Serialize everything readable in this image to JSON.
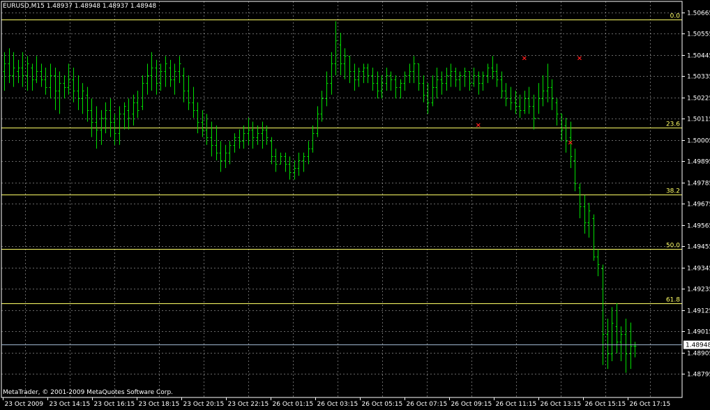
{
  "window": {
    "symbol_header": "EURUSD,M15  1.48937 1.48948 1.48937 1.48948",
    "copyright": "MetaTrader, © 2001-2009 MetaQuotes Software Corp."
  },
  "colors": {
    "background": "#000000",
    "grid": "#c0c0c0",
    "bars": "#00e000",
    "fibo": "#ffff66",
    "fractal": "#ff2020",
    "axis_text": "#ffffff",
    "current_price_line": "#a0b8d0"
  },
  "chart_data": {
    "type": "bar",
    "title": "EURUSD,M15",
    "symbol": "EURUSD",
    "timeframe": "M15",
    "last_quote": {
      "open": 1.48937,
      "high": 1.48948,
      "low": 1.48937,
      "close": 1.48948
    },
    "current_price": "1.48948",
    "y_ticks": [
      "1.50665",
      "1.50555",
      "1.50445",
      "1.50335",
      "1.50225",
      "1.50115",
      "1.50005",
      "1.49895",
      "1.49785",
      "1.49675",
      "1.49565",
      "1.49455",
      "1.49345",
      "1.49235",
      "1.49125",
      "1.49015",
      "1.48905",
      "1.48795"
    ],
    "x_ticks": [
      "23 Oct 2009",
      "23 Oct 14:15",
      "23 Oct 16:15",
      "23 Oct 18:15",
      "23 Oct 20:15",
      "23 Oct 22:15",
      "26 Oct 01:15",
      "26 Oct 03:15",
      "26 Oct 05:15",
      "26 Oct 07:15",
      "26 Oct 09:15",
      "26 Oct 11:15",
      "26 Oct 13:15",
      "26 Oct 15:15",
      "26 Oct 17:15"
    ],
    "ylim": [
      1.4874,
      1.5072
    ],
    "grid": true,
    "fibonacci_levels": [
      {
        "label": "0.0",
        "price": 1.5063
      },
      {
        "label": "23.6",
        "price": 1.50068
      },
      {
        "label": "38.2",
        "price": 1.49722
      },
      {
        "label": "50.0",
        "price": 1.4944
      },
      {
        "label": "61.8",
        "price": 1.4916
      }
    ],
    "ohlc": [
      {
        "h": 1.5046,
        "l": 1.5026,
        "o": 1.5036,
        "c": 1.504
      },
      {
        "h": 1.5048,
        "l": 1.503,
        "o": 1.504,
        "c": 1.5034
      },
      {
        "h": 1.5046,
        "l": 1.5028,
        "o": 1.5034,
        "c": 1.5038
      },
      {
        "h": 1.5042,
        "l": 1.503,
        "o": 1.5036,
        "c": 1.5038
      },
      {
        "h": 1.5046,
        "l": 1.5028,
        "o": 1.5038,
        "c": 1.5034
      },
      {
        "h": 1.5044,
        "l": 1.5026,
        "o": 1.5034,
        "c": 1.504
      },
      {
        "h": 1.504,
        "l": 1.5026,
        "o": 1.5038,
        "c": 1.5032
      },
      {
        "h": 1.5044,
        "l": 1.503,
        "o": 1.5032,
        "c": 1.5036
      },
      {
        "h": 1.504,
        "l": 1.5028,
        "o": 1.5036,
        "c": 1.5032
      },
      {
        "h": 1.5038,
        "l": 1.5024,
        "o": 1.5032,
        "c": 1.5028
      },
      {
        "h": 1.504,
        "l": 1.5022,
        "o": 1.5028,
        "c": 1.5034
      },
      {
        "h": 1.5038,
        "l": 1.5016,
        "o": 1.5034,
        "c": 1.5026
      },
      {
        "h": 1.5036,
        "l": 1.5014,
        "o": 1.5026,
        "c": 1.503
      },
      {
        "h": 1.5034,
        "l": 1.5022,
        "o": 1.503,
        "c": 1.5028
      },
      {
        "h": 1.504,
        "l": 1.5024,
        "o": 1.5028,
        "c": 1.5032
      },
      {
        "h": 1.5038,
        "l": 1.502,
        "o": 1.5032,
        "c": 1.5026
      },
      {
        "h": 1.5034,
        "l": 1.5016,
        "o": 1.5026,
        "c": 1.5022
      },
      {
        "h": 1.503,
        "l": 1.5014,
        "o": 1.5022,
        "c": 1.5026
      },
      {
        "h": 1.5028,
        "l": 1.501,
        "o": 1.5024,
        "c": 1.5016
      },
      {
        "h": 1.5022,
        "l": 1.5002,
        "o": 1.5016,
        "c": 1.501
      },
      {
        "h": 1.5018,
        "l": 1.4996,
        "o": 1.501,
        "c": 1.5006
      },
      {
        "h": 1.5016,
        "l": 1.4998,
        "o": 1.5006,
        "c": 1.5012
      },
      {
        "h": 1.502,
        "l": 1.5004,
        "o": 1.5012,
        "c": 1.5016
      },
      {
        "h": 1.5022,
        "l": 1.5002,
        "o": 1.5016,
        "c": 1.501
      },
      {
        "h": 1.5014,
        "l": 1.4998,
        "o": 1.501,
        "c": 1.5004
      },
      {
        "h": 1.5018,
        "l": 1.4998,
        "o": 1.5004,
        "c": 1.5014
      },
      {
        "h": 1.502,
        "l": 1.5006,
        "o": 1.5014,
        "c": 1.5018
      },
      {
        "h": 1.5022,
        "l": 1.5006,
        "o": 1.5016,
        "c": 1.5012
      },
      {
        "h": 1.5024,
        "l": 1.5008,
        "o": 1.5014,
        "c": 1.502
      },
      {
        "h": 1.5026,
        "l": 1.5012,
        "o": 1.502,
        "c": 1.5016
      },
      {
        "h": 1.5034,
        "l": 1.5016,
        "o": 1.5018,
        "c": 1.503
      },
      {
        "h": 1.504,
        "l": 1.5024,
        "o": 1.503,
        "c": 1.5034
      },
      {
        "h": 1.5046,
        "l": 1.5026,
        "o": 1.5034,
        "c": 1.5038
      },
      {
        "h": 1.5042,
        "l": 1.5024,
        "o": 1.5038,
        "c": 1.503
      },
      {
        "h": 1.504,
        "l": 1.5026,
        "o": 1.503,
        "c": 1.5036
      },
      {
        "h": 1.5044,
        "l": 1.5028,
        "o": 1.5036,
        "c": 1.504
      },
      {
        "h": 1.5042,
        "l": 1.5028,
        "o": 1.5038,
        "c": 1.5032
      },
      {
        "h": 1.504,
        "l": 1.5024,
        "o": 1.5032,
        "c": 1.5036
      },
      {
        "h": 1.5044,
        "l": 1.503,
        "o": 1.5036,
        "c": 1.504
      },
      {
        "h": 1.5038,
        "l": 1.502,
        "o": 1.5034,
        "c": 1.5026
      },
      {
        "h": 1.5034,
        "l": 1.5016,
        "o": 1.5026,
        "c": 1.502
      },
      {
        "h": 1.5028,
        "l": 1.5012,
        "o": 1.502,
        "c": 1.5016
      },
      {
        "h": 1.502,
        "l": 1.5004,
        "o": 1.5016,
        "c": 1.501
      },
      {
        "h": 1.5016,
        "l": 1.5002,
        "o": 1.501,
        "c": 1.5006
      },
      {
        "h": 1.5014,
        "l": 1.4998,
        "o": 1.5006,
        "c": 1.5002
      },
      {
        "h": 1.501,
        "l": 1.4992,
        "o": 1.5002,
        "c": 1.4998
      },
      {
        "h": 1.5008,
        "l": 1.499,
        "o": 1.4998,
        "c": 1.4994
      },
      {
        "h": 1.5,
        "l": 1.4984,
        "o": 1.4994,
        "c": 1.499
      },
      {
        "h": 1.4998,
        "l": 1.4986,
        "o": 1.499,
        "c": 1.4994
      },
      {
        "h": 1.5,
        "l": 1.4988,
        "o": 1.4994,
        "c": 1.4998
      },
      {
        "h": 1.5004,
        "l": 1.4994,
        "o": 1.4998,
        "c": 1.5002
      },
      {
        "h": 1.5006,
        "l": 1.4996,
        "o": 1.5002,
        "c": 1.5
      },
      {
        "h": 1.5008,
        "l": 1.4996,
        "o": 1.5,
        "c": 1.5004
      },
      {
        "h": 1.5012,
        "l": 1.4998,
        "o": 1.5004,
        "c": 1.5006
      },
      {
        "h": 1.501,
        "l": 1.4996,
        "o": 1.5006,
        "c": 1.5002
      },
      {
        "h": 1.5008,
        "l": 1.4998,
        "o": 1.5002,
        "c": 1.5004
      },
      {
        "h": 1.501,
        "l": 1.4996,
        "o": 1.5004,
        "c": 1.5006
      },
      {
        "h": 1.5008,
        "l": 1.4998,
        "o": 1.5006,
        "c": 1.5002
      },
      {
        "h": 1.5002,
        "l": 1.4988,
        "o": 1.5,
        "c": 1.4992
      },
      {
        "h": 1.4996,
        "l": 1.4984,
        "o": 1.4992,
        "c": 1.4988
      },
      {
        "h": 1.4994,
        "l": 1.4988,
        "o": 1.4988,
        "c": 1.4992
      },
      {
        "h": 1.4994,
        "l": 1.4984,
        "o": 1.4992,
        "c": 1.4988
      },
      {
        "h": 1.4992,
        "l": 1.498,
        "o": 1.4988,
        "c": 1.4984
      },
      {
        "h": 1.499,
        "l": 1.498,
        "o": 1.4984,
        "c": 1.4986
      },
      {
        "h": 1.4994,
        "l": 1.4982,
        "o": 1.4986,
        "c": 1.499
      },
      {
        "h": 1.4994,
        "l": 1.4984,
        "o": 1.499,
        "c": 1.4992
      },
      {
        "h": 1.5,
        "l": 1.4988,
        "o": 1.4992,
        "c": 1.4996
      },
      {
        "h": 1.5008,
        "l": 1.4994,
        "o": 1.4996,
        "c": 1.5004
      },
      {
        "h": 1.5018,
        "l": 1.5002,
        "o": 1.5004,
        "c": 1.5014
      },
      {
        "h": 1.5026,
        "l": 1.501,
        "o": 1.5014,
        "c": 1.5022
      },
      {
        "h": 1.5036,
        "l": 1.5018,
        "o": 1.5022,
        "c": 1.503
      },
      {
        "h": 1.5046,
        "l": 1.5024,
        "o": 1.503,
        "c": 1.504
      },
      {
        "h": 1.5062,
        "l": 1.5034,
        "o": 1.504,
        "c": 1.5052
      },
      {
        "h": 1.5056,
        "l": 1.5034,
        "o": 1.505,
        "c": 1.504
      },
      {
        "h": 1.5048,
        "l": 1.5032,
        "o": 1.504,
        "c": 1.5044
      },
      {
        "h": 1.5044,
        "l": 1.503,
        "o": 1.5044,
        "c": 1.5036
      },
      {
        "h": 1.504,
        "l": 1.5026,
        "o": 1.5036,
        "c": 1.5032
      },
      {
        "h": 1.5038,
        "l": 1.5028,
        "o": 1.5032,
        "c": 1.5036
      },
      {
        "h": 1.504,
        "l": 1.503,
        "o": 1.5036,
        "c": 1.5038
      },
      {
        "h": 1.504,
        "l": 1.503,
        "o": 1.5038,
        "c": 1.5034
      },
      {
        "h": 1.5038,
        "l": 1.5026,
        "o": 1.5034,
        "c": 1.503
      },
      {
        "h": 1.5036,
        "l": 1.5022,
        "o": 1.503,
        "c": 1.5026
      },
      {
        "h": 1.5034,
        "l": 1.5022,
        "o": 1.5026,
        "c": 1.503
      },
      {
        "h": 1.5038,
        "l": 1.5026,
        "o": 1.503,
        "c": 1.5034
      },
      {
        "h": 1.5036,
        "l": 1.5026,
        "o": 1.5034,
        "c": 1.5032
      },
      {
        "h": 1.5034,
        "l": 1.5022,
        "o": 1.5032,
        "c": 1.5028
      },
      {
        "h": 1.5032,
        "l": 1.5022,
        "o": 1.5028,
        "c": 1.503
      },
      {
        "h": 1.5036,
        "l": 1.5026,
        "o": 1.503,
        "c": 1.5034
      },
      {
        "h": 1.504,
        "l": 1.503,
        "o": 1.5034,
        "c": 1.5036
      },
      {
        "h": 1.5044,
        "l": 1.503,
        "o": 1.5036,
        "c": 1.504
      },
      {
        "h": 1.504,
        "l": 1.5026,
        "o": 1.504,
        "c": 1.503
      },
      {
        "h": 1.5034,
        "l": 1.502,
        "o": 1.503,
        "c": 1.5024
      },
      {
        "h": 1.503,
        "l": 1.5014,
        "o": 1.5024,
        "c": 1.502
      },
      {
        "h": 1.5034,
        "l": 1.5018,
        "o": 1.502,
        "c": 1.5028
      },
      {
        "h": 1.5038,
        "l": 1.5022,
        "o": 1.5028,
        "c": 1.5032
      },
      {
        "h": 1.5036,
        "l": 1.5024,
        "o": 1.5032,
        "c": 1.503
      },
      {
        "h": 1.5038,
        "l": 1.5026,
        "o": 1.503,
        "c": 1.5034
      },
      {
        "h": 1.504,
        "l": 1.5028,
        "o": 1.5034,
        "c": 1.5036
      },
      {
        "h": 1.5038,
        "l": 1.5028,
        "o": 1.5036,
        "c": 1.5032
      },
      {
        "h": 1.5036,
        "l": 1.5026,
        "o": 1.5032,
        "c": 1.5034
      },
      {
        "h": 1.5038,
        "l": 1.5028,
        "o": 1.5034,
        "c": 1.5036
      },
      {
        "h": 1.5036,
        "l": 1.5026,
        "o": 1.5036,
        "c": 1.503
      },
      {
        "h": 1.5038,
        "l": 1.5028,
        "o": 1.503,
        "c": 1.5034
      },
      {
        "h": 1.5036,
        "l": 1.5024,
        "o": 1.5034,
        "c": 1.503
      },
      {
        "h": 1.5036,
        "l": 1.5026,
        "o": 1.503,
        "c": 1.5034
      },
      {
        "h": 1.504,
        "l": 1.503,
        "o": 1.5034,
        "c": 1.5038
      },
      {
        "h": 1.5044,
        "l": 1.5032,
        "o": 1.5038,
        "c": 1.5036
      },
      {
        "h": 1.504,
        "l": 1.5028,
        "o": 1.5036,
        "c": 1.5032
      },
      {
        "h": 1.5036,
        "l": 1.5022,
        "o": 1.5032,
        "c": 1.5026
      },
      {
        "h": 1.503,
        "l": 1.5018,
        "o": 1.5026,
        "c": 1.5022
      },
      {
        "h": 1.5028,
        "l": 1.5016,
        "o": 1.5022,
        "c": 1.502
      },
      {
        "h": 1.5026,
        "l": 1.5014,
        "o": 1.502,
        "c": 1.5018
      },
      {
        "h": 1.5024,
        "l": 1.5012,
        "o": 1.5018,
        "c": 1.5016
      },
      {
        "h": 1.5026,
        "l": 1.5014,
        "o": 1.5016,
        "c": 1.5022
      },
      {
        "h": 1.5028,
        "l": 1.5014,
        "o": 1.5022,
        "c": 1.5018
      },
      {
        "h": 1.5024,
        "l": 1.5006,
        "o": 1.5018,
        "c": 1.5012
      },
      {
        "h": 1.503,
        "l": 1.5014,
        "o": 1.5012,
        "c": 1.5022
      },
      {
        "h": 1.5034,
        "l": 1.5018,
        "o": 1.5022,
        "c": 1.5026
      },
      {
        "h": 1.504,
        "l": 1.502,
        "o": 1.5026,
        "c": 1.5028
      },
      {
        "h": 1.5032,
        "l": 1.5016,
        "o": 1.5028,
        "c": 1.5022
      },
      {
        "h": 1.5022,
        "l": 1.5008,
        "o": 1.502,
        "c": 1.5014
      },
      {
        "h": 1.5014,
        "l": 1.5,
        "o": 1.5014,
        "c": 1.5006
      },
      {
        "h": 1.5012,
        "l": 1.4994,
        "o": 1.5008,
        "c": 1.5
      },
      {
        "h": 1.501,
        "l": 1.4986,
        "o": 1.5002,
        "c": 1.4992
      },
      {
        "h": 1.4996,
        "l": 1.4974,
        "o": 1.499,
        "c": 1.4978
      },
      {
        "h": 1.4978,
        "l": 1.496,
        "o": 1.4976,
        "c": 1.4966
      },
      {
        "h": 1.4972,
        "l": 1.4952,
        "o": 1.4966,
        "c": 1.4958
      },
      {
        "h": 1.4968,
        "l": 1.495,
        "o": 1.4958,
        "c": 1.4964
      },
      {
        "h": 1.4962,
        "l": 1.4938,
        "o": 1.496,
        "c": 1.494
      },
      {
        "h": 1.4944,
        "l": 1.493,
        "o": 1.494,
        "c": 1.4936
      },
      {
        "h": 1.4936,
        "l": 1.4884,
        "o": 1.4934,
        "c": 1.49
      },
      {
        "h": 1.4908,
        "l": 1.4882,
        "o": 1.49,
        "c": 1.489
      },
      {
        "h": 1.4914,
        "l": 1.4886,
        "o": 1.489,
        "c": 1.4906
      },
      {
        "h": 1.4916,
        "l": 1.489,
        "o": 1.4904,
        "c": 1.4896
      },
      {
        "h": 1.4904,
        "l": 1.4886,
        "o": 1.4896,
        "c": 1.49
      },
      {
        "h": 1.4908,
        "l": 1.488,
        "o": 1.49,
        "c": 1.489
      },
      {
        "h": 1.4906,
        "l": 1.4882,
        "o": 1.489,
        "c": 1.4894
      },
      {
        "h": 1.4896,
        "l": 1.4888,
        "o": 1.4894,
        "c": 1.4894
      }
    ],
    "fractals": [
      {
        "type": "up",
        "bar": 113,
        "price": 1.504
      },
      {
        "type": "up",
        "bar": 125,
        "price": 1.504
      },
      {
        "type": "down",
        "bar": 103,
        "price": 1.5011
      },
      {
        "type": "down",
        "bar": 123,
        "price": 1.5002
      }
    ]
  }
}
